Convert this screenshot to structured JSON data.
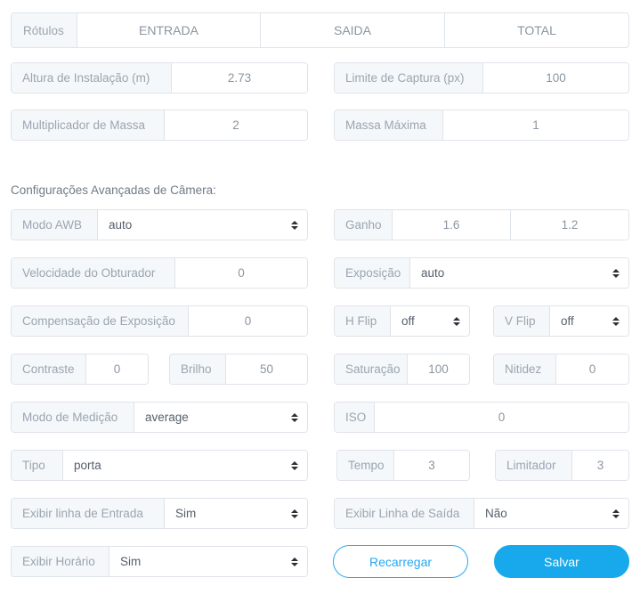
{
  "tabs": {
    "label": "Rótulos",
    "items": [
      {
        "label": "ENTRADA"
      },
      {
        "label": "SAIDA"
      },
      {
        "label": "TOTAL"
      }
    ]
  },
  "basic_fields": [
    {
      "label": "Altura de Instalação (m)",
      "value": "2.73"
    },
    {
      "label": "Limite de Captura (px)",
      "value": "100"
    },
    {
      "label": "Multiplicador de Massa",
      "value": "2"
    },
    {
      "label": "Massa Máxima",
      "value": "1"
    }
  ],
  "advanced": {
    "heading": "Configurações Avançadas de Câmera:",
    "awb_mode": {
      "label": "Modo AWB",
      "value": "auto"
    },
    "gain": {
      "label": "Ganho",
      "value1": "1.6",
      "value2": "1.2"
    },
    "shutter_speed": {
      "label": "Velocidade do Obturador",
      "value": "0"
    },
    "exposure": {
      "label": "Exposição",
      "value": "auto"
    },
    "exposure_compensation": {
      "label": "Compensação de Exposição",
      "value": "0"
    },
    "h_flip": {
      "label": "H Flip",
      "value": "off"
    },
    "v_flip": {
      "label": "V Flip",
      "value": "off"
    },
    "contrast": {
      "label": "Contraste",
      "value": "0"
    },
    "brightness": {
      "label": "Brilho",
      "value": "50"
    },
    "saturation": {
      "label": "Saturação",
      "value": "100"
    },
    "sharpness": {
      "label": "Nitidez",
      "value": "0"
    },
    "metering_mode": {
      "label": "Modo de Medição",
      "value": "average"
    },
    "iso": {
      "label": "ISO",
      "value": "0"
    },
    "type": {
      "label": "Tipo",
      "value": "porta"
    },
    "time": {
      "label": "Tempo",
      "value": "3"
    },
    "limiter": {
      "label": "Limitador",
      "value": "3"
    },
    "show_entry_line": {
      "label": "Exibir linha de Entrada",
      "value": "Sim"
    },
    "show_exit_line": {
      "label": "Exibir Linha de Saída",
      "value": "Não"
    },
    "show_time": {
      "label": "Exibir Horário",
      "value": "Sim"
    }
  },
  "actions": {
    "reload": "Recarregar",
    "save": "Salvar"
  },
  "colors": {
    "primary": "#17a9ec",
    "outline": "#23a9f2",
    "label_bg": "#f5f8fa",
    "border": "#dfe4ea",
    "label_text": "#9aa5b1",
    "value_text": "#8b95a1"
  }
}
